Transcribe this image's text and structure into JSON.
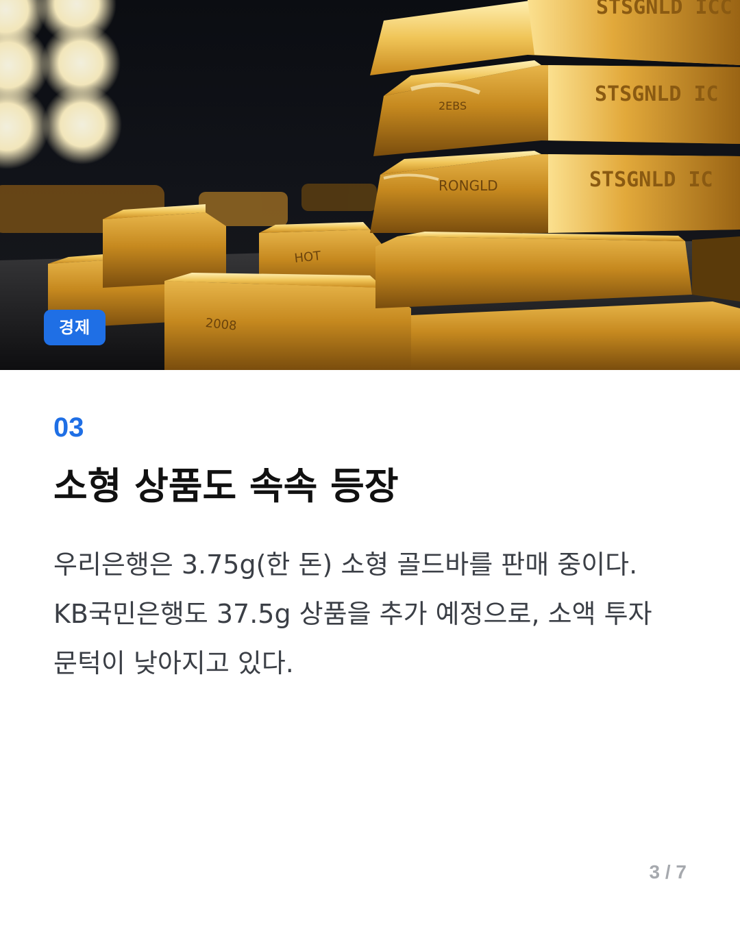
{
  "category_badge": "경제",
  "section_number": "03",
  "headline": "소형 상품도 속속 등장",
  "body": "우리은행은 3.75g(한 돈) 소형 골드바를 판매 중이다. KB국민은행도 37.5g 상품을 추가 예정으로, 소액 투자 문턱이 낮아지고 있다.",
  "pagination": "3 / 7",
  "hero_image": {
    "subject": "stacked gold bars",
    "bar_inscriptions": [
      "STSGNLD ICC",
      "STSGNLD IC",
      "STSGNLD IC",
      "2EBS",
      "RONGLD",
      "HOT",
      "2008"
    ]
  },
  "colors": {
    "accent": "#1f6fe5",
    "headline": "#111111",
    "body": "#3b3f46",
    "pagination": "#a6a9ae",
    "gold": "#d9a53a"
  }
}
